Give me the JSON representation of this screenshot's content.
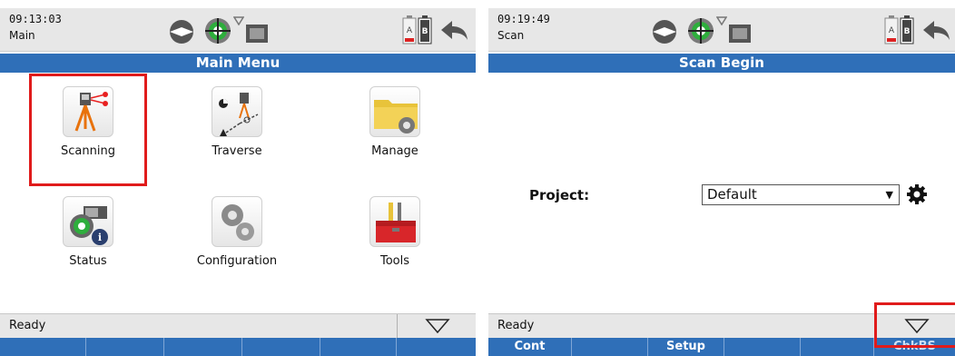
{
  "screens": [
    {
      "time": "09:13:03",
      "mode": "Main",
      "title": "Main Menu",
      "menu": [
        {
          "label": "Scanning",
          "icon": "scanner-icon"
        },
        {
          "label": "Traverse",
          "icon": "traverse-icon"
        },
        {
          "label": "Manage",
          "icon": "folder-gear-icon"
        },
        {
          "label": "Status",
          "icon": "status-icon"
        },
        {
          "label": "Configuration",
          "icon": "gears-icon"
        },
        {
          "label": "Tools",
          "icon": "toolbox-icon"
        }
      ],
      "status": "Ready",
      "softkeys": [
        "",
        "",
        "",
        "",
        "",
        ""
      ]
    },
    {
      "time": "09:19:49",
      "mode": "Scan",
      "title": "Scan Begin",
      "project_label": "Project:",
      "project_value": "Default",
      "status": "Ready",
      "softkeys": [
        "Cont",
        "",
        "Setup",
        "",
        "",
        "ChkBS"
      ]
    }
  ],
  "colors": {
    "accent": "#2f6fb8",
    "highlight": "#e01b1b"
  }
}
